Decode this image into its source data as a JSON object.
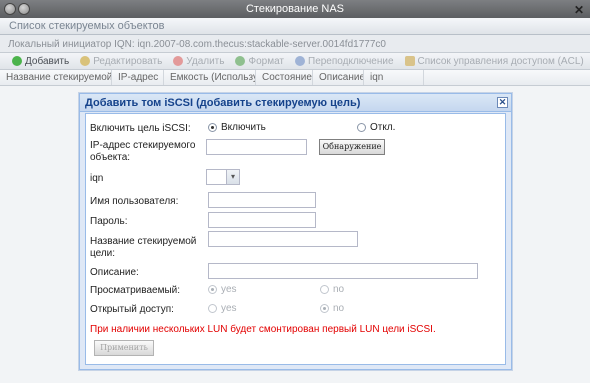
{
  "window": {
    "title": "Стекирование NAS",
    "close_glyph": "✕"
  },
  "panel": {
    "title": "Список стекируемых объектов",
    "iqn_line": "Локальный инициатор IQN: iqn.2007-08.com.thecus:stackable-server.0014fd1777c0"
  },
  "toolbar": {
    "add": "Добавить",
    "edit": "Редактировать",
    "delete": "Удалить",
    "format": "Формат",
    "convert": "Переподключение",
    "acl": "Список управления доступом (ACL)"
  },
  "columns": [
    "Название стекируемой...",
    "IP-адрес",
    "Емкость (Использу...",
    "Состояние",
    "Описание",
    "iqn"
  ],
  "modal": {
    "title": "Добавить том iSCSI (добавить стекируемую цель)",
    "close_glyph": "✕",
    "enable_label": "Включить цель iSCSI:",
    "enable_on": "Включить",
    "enable_off": "Откл.",
    "ip_label": "IP-адрес стекируемого объекта:",
    "ip_value": "",
    "discover_button": "Обнаружение",
    "iqn_label": "iqn",
    "iqn_value": "",
    "combo_arrow": "▾",
    "username_label": "Имя пользователя:",
    "username_value": "",
    "password_label": "Пароль:",
    "password_value": "",
    "target_name_label": "Название стекируемой цели:",
    "target_name_value": "",
    "description_label": "Описание:",
    "description_value": "",
    "browsable_label": "Просматриваемый:",
    "browsable_yes": "yes",
    "browsable_no": "no",
    "public_label": "Открытый доступ:",
    "public_yes": "yes",
    "public_no": "no",
    "warning": "При наличии нескольких LUN будет смонтирован первый LUN цели iSCSI.",
    "apply_button": "Применить"
  }
}
